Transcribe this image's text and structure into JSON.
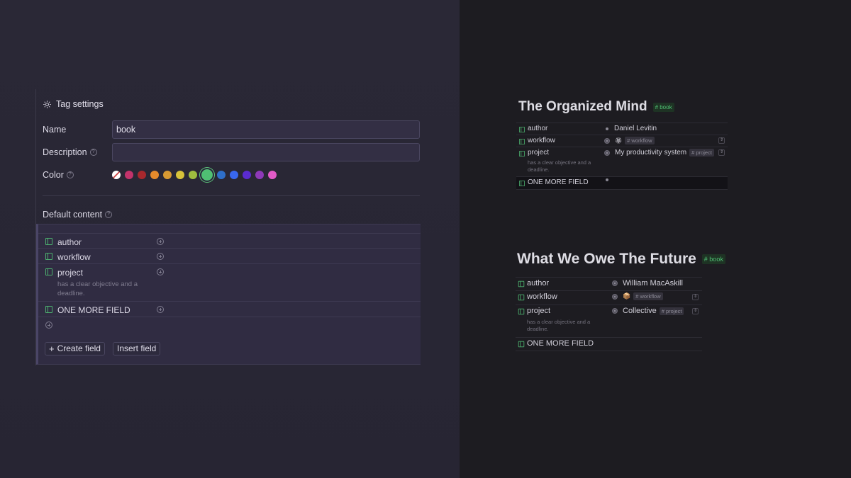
{
  "tag_settings": {
    "header": "Tag settings",
    "name_label": "Name",
    "name_value": "book",
    "description_label": "Description",
    "description_value": "",
    "color_label": "Color",
    "colors": [
      "none",
      "#c2336b",
      "#a8282d",
      "#e58a2c",
      "#d89a33",
      "#d7c23a",
      "#9fbd3f",
      "#4fbf73",
      "#2e6fc9",
      "#3867f0",
      "#5a2bd1",
      "#8e39b8",
      "#e25bc8"
    ],
    "selected_color": "#4fbf73",
    "default_content_label": "Default content",
    "fields": [
      {
        "name": "author",
        "description": ""
      },
      {
        "name": "workflow",
        "description": ""
      },
      {
        "name": "project",
        "description": "has a clear objective and a deadline."
      },
      {
        "name": "ONE MORE FIELD",
        "description": ""
      }
    ],
    "create_field_label": "Create field",
    "insert_field_label": "Insert field"
  },
  "node1": {
    "title": "The Organized Mind",
    "tag": "# book",
    "fields": [
      {
        "name": "author",
        "value": "Daniel Levitin",
        "ref": ""
      },
      {
        "name": "workflow",
        "value": "",
        "ref": "# workflow",
        "emoji": "🏵"
      },
      {
        "name": "project",
        "value": "My productivity system",
        "ref": "# project",
        "description": "has a clear objective and a deadline."
      },
      {
        "name": "ONE MORE FIELD",
        "value": "",
        "ref": ""
      }
    ]
  },
  "node2": {
    "title": "What We Owe The Future",
    "tag": "# book",
    "fields": [
      {
        "name": "author",
        "value": "William MacAskill",
        "ref": ""
      },
      {
        "name": "workflow",
        "value": "",
        "ref": "# workflow",
        "emoji": "📦"
      },
      {
        "name": "project",
        "value": "Collective",
        "ref": "# project",
        "description": "has a clear objective and a deadline."
      },
      {
        "name": "ONE MORE FIELD",
        "value": "",
        "ref": ""
      }
    ]
  }
}
